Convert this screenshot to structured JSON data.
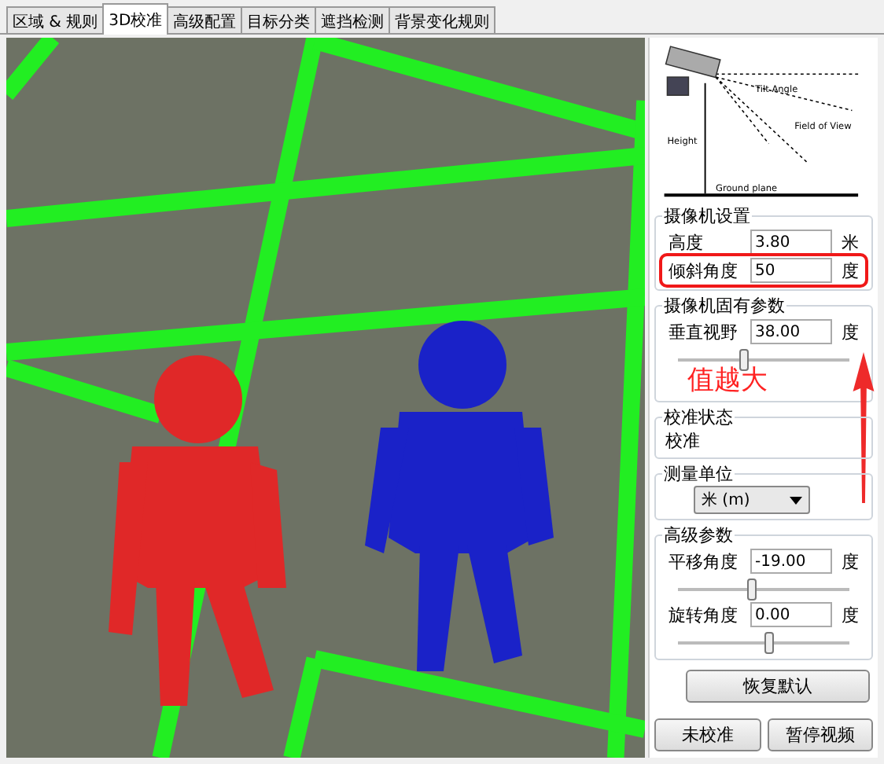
{
  "tabs": [
    {
      "label": "区域 & 规则",
      "selected": false
    },
    {
      "label": "3D校准",
      "selected": true
    },
    {
      "label": "高级配置",
      "selected": false
    },
    {
      "label": "目标分类",
      "selected": false
    },
    {
      "label": "遮挡检测",
      "selected": false
    },
    {
      "label": "背景变化规则",
      "selected": false
    }
  ],
  "diagram": {
    "labels": [
      "Tilt Angle",
      "Field of View",
      "Height",
      "Ground plane"
    ]
  },
  "camera_settings": {
    "title": "摄像机设置",
    "height": {
      "label": "高度",
      "value": "3.80",
      "unit": "米"
    },
    "tilt": {
      "label": "倾斜角度",
      "value": "50",
      "unit": "度",
      "highlighted": true
    }
  },
  "intrinsics": {
    "title": "摄像机固有参数",
    "fov": {
      "label": "垂直视野",
      "value": "38.00",
      "unit": "度",
      "level": 0.36
    }
  },
  "annotation": {
    "text": "值越大"
  },
  "calibration_status": {
    "title": "校准状态",
    "value": "校准"
  },
  "units": {
    "title": "测量单位",
    "value": "米 (m)"
  },
  "advanced": {
    "title": "高级参数",
    "pan": {
      "label": "平移角度",
      "value": "-19.00",
      "unit": "度",
      "level": 0.4
    },
    "rotate": {
      "label": "旋转角度",
      "value": "0.00",
      "unit": "度",
      "level": 0.5
    }
  },
  "buttons": {
    "reset": "恢复默认",
    "calibrate": "未校准",
    "pause": "暂停视频"
  }
}
